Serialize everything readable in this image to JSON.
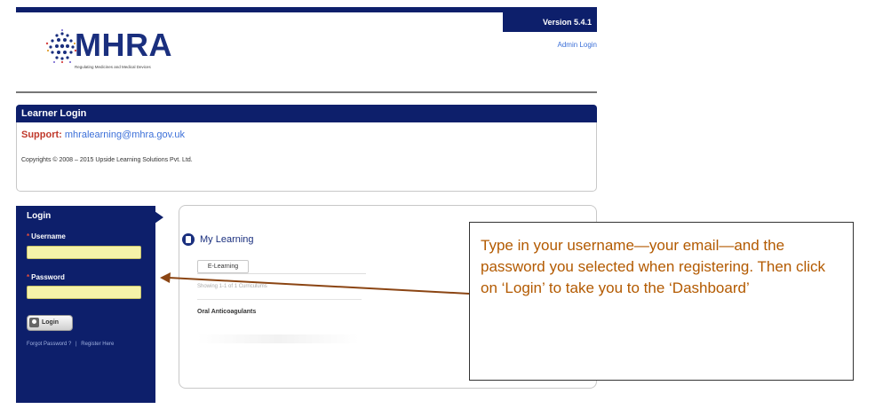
{
  "header": {
    "version": "Version 5.4.1",
    "admin_login": "Admin Login",
    "logo_text": "MHRA",
    "logo_tagline": "Regulating Medicines and Medical Devices"
  },
  "learner_panel": {
    "title": "Learner Login",
    "support_label": "Support:",
    "support_email": "mhralearning@mhra.gov.uk",
    "copyright": "Copyrights © 2008 – 2015 Upside Learning Solutions Pvt. Ltd."
  },
  "login_form": {
    "title": "Login",
    "required_mark": "*",
    "username_label": "Username",
    "username_value": "",
    "password_label": "Password",
    "password_value": "",
    "login_button": "Login",
    "forgot_password": "Forgot Password ?",
    "separator": "|",
    "register": "Register Here"
  },
  "my_learning": {
    "title": "My Learning",
    "tab": "E-Learning",
    "showing": "Showing 1-1 of 1 Curriculums",
    "items": [
      "Oral Anticoagulants"
    ]
  },
  "callout": {
    "text": "Type in your username—your email—and the password you selected when registering. Then click on ‘Login’ to take you to the ‘Dashboard’"
  },
  "colors": {
    "navy": "#0d1f6b",
    "field_yellow": "#f6f3a9",
    "callout_text": "#b35a00",
    "arrow": "#8b4513",
    "support_label": "#c0392b",
    "link_blue": "#3b6fd8"
  }
}
